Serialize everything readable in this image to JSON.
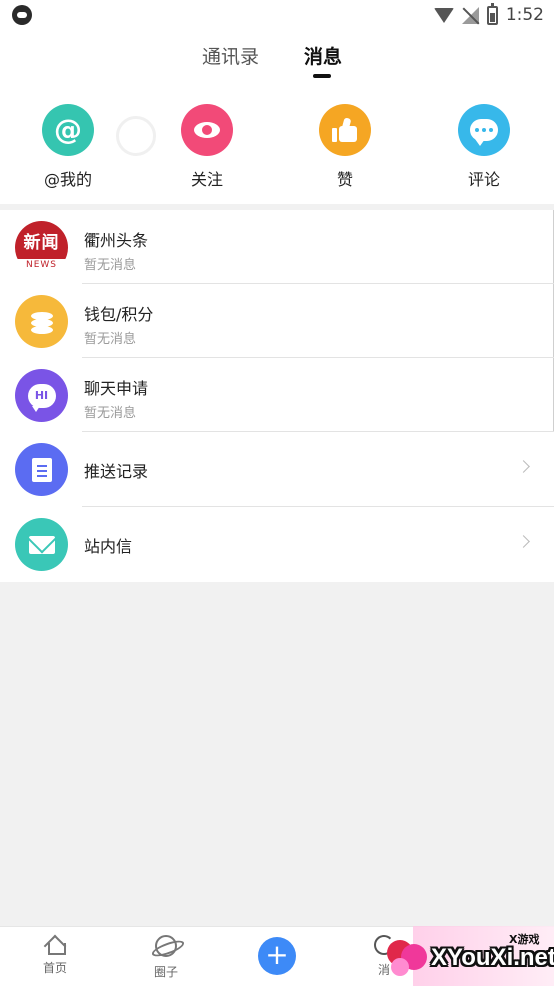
{
  "status_bar": {
    "time": "1:52"
  },
  "tabs": [
    {
      "label": "通讯录"
    },
    {
      "label": "消息"
    }
  ],
  "quick_actions": [
    {
      "label": "@我的",
      "glyph": "@",
      "icon": "at-icon",
      "color": "#35c5b0"
    },
    {
      "label": "关注",
      "icon": "eye-icon",
      "color": "#f24a78"
    },
    {
      "label": "赞",
      "icon": "thumbs-up-icon",
      "color": "#f5a623"
    },
    {
      "label": "评论",
      "icon": "comment-icon",
      "color": "#37b8ea"
    }
  ],
  "list": [
    {
      "title": "衢州头条",
      "subtitle": "暂无消息",
      "icon_top": "新闻",
      "icon_bottom": "NEWS",
      "icon": "news-logo-icon"
    },
    {
      "title": "钱包/积分",
      "subtitle": "暂无消息",
      "icon": "coins-icon",
      "color": "#f6b93b"
    },
    {
      "title": "聊天申请",
      "subtitle": "暂无消息",
      "icon_text": "HI",
      "icon": "chat-hi-icon",
      "color": "#7a54e6"
    },
    {
      "title": "推送记录",
      "icon": "document-icon",
      "color": "#5b6cf2"
    },
    {
      "title": "站内信",
      "icon": "mail-icon",
      "color": "#3ac7b7"
    }
  ],
  "bottom_nav": [
    {
      "label": "首页",
      "icon": "home-icon"
    },
    {
      "label": "圈子",
      "icon": "planet-icon"
    },
    {
      "label": "+",
      "icon": "add-icon",
      "color": "#3d8af7"
    },
    {
      "label": "消",
      "icon": "refresh-icon"
    }
  ],
  "watermark": {
    "small": "X游戏",
    "big": "XYouXi.net"
  }
}
